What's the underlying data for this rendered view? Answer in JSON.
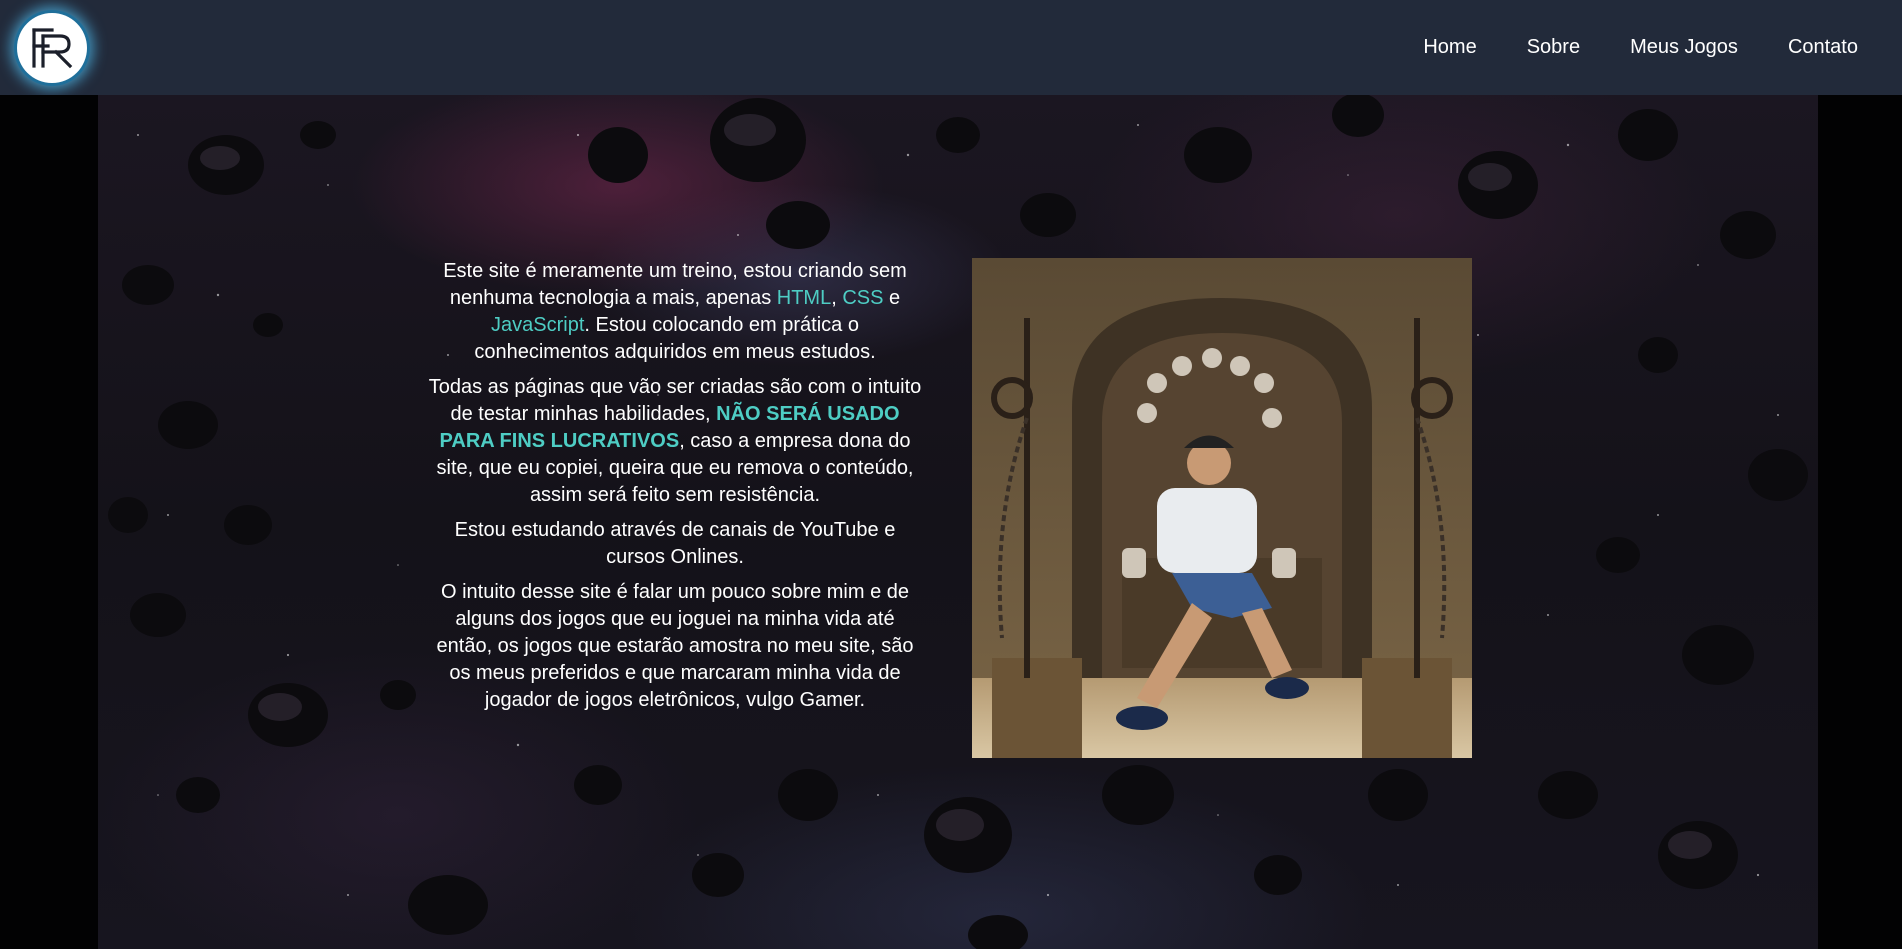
{
  "header": {
    "logo_text": "FR",
    "nav": [
      {
        "label": "Home"
      },
      {
        "label": "Sobre"
      },
      {
        "label": "Meus Jogos"
      },
      {
        "label": "Contato"
      }
    ]
  },
  "about": {
    "p1": {
      "a": "Este site é meramente um treino, estou criando sem nenhuma tecnologia a mais, apenas ",
      "html": "HTML",
      "b": ", ",
      "css": "CSS",
      "c": " e ",
      "js": "JavaScript",
      "d": ". Estou colocando em prática o conhecimentos adquiridos em meus estudos."
    },
    "p2": {
      "a": "Todas as páginas que vão ser criadas são com o intuito de testar minhas habilidades, ",
      "bold": "NÃO SERÁ USADO PARA FINS LUCRATIVOS",
      "b": ", caso a empresa dona do site, que eu copiei, queira que eu remova o conteúdo, assim será feito sem resistência."
    },
    "p3": "Estou estudando através de canais de YouTube e cursos Onlines.",
    "p4": "O intuito desse site é falar um pouco sobre mim e de alguns dos jogos que eu joguei na minha vida até então, os jogos que estarão amostra no meu site, são os meus preferidos e que marcaram minha vida de jogador de jogos eletrônicos, vulgo Gamer."
  },
  "colors": {
    "nav_bg": "#222a3a",
    "accent": "#4ecdc4",
    "text": "#ffffff"
  },
  "photo": {
    "description_icon": "profile-photo"
  }
}
